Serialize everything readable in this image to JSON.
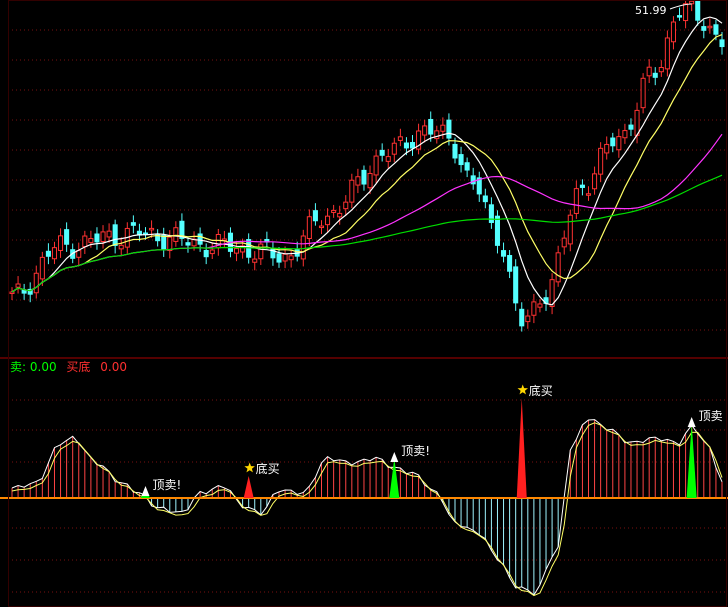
{
  "colors": {
    "background": "#000000",
    "up_candle": "#ff3232",
    "down_candle": "#54ffff",
    "ma_short": "#ffffff",
    "ma_mid": "#ffff66",
    "ma_long": "#ff33ff",
    "ma_longest": "#00dd00",
    "grid": "#7a1010",
    "separator": "#aa0000",
    "zero_line": "#ff8800",
    "bottom_buy": "#ff2020",
    "top_sell": "#00ff00",
    "annotation_text": "#ffffff",
    "label_sell": "#00ff00",
    "label_buy": "#ff3030"
  },
  "header": {
    "sell_label": "卖",
    "sell_value": "0.00",
    "bottom_label": "买底",
    "bottom_value": "0.00"
  },
  "price_high_label": "51.99",
  "chart_data": [
    {
      "type": "candlestick",
      "title": "",
      "x_count": 118,
      "max_price": 51.99,
      "max_index": 112,
      "trend_anchors": [
        [
          0,
          0.1
        ],
        [
          8,
          0.26
        ],
        [
          20,
          0.3
        ],
        [
          35,
          0.26
        ],
        [
          45,
          0.23
        ],
        [
          52,
          0.36
        ],
        [
          62,
          0.55
        ],
        [
          68,
          0.62
        ],
        [
          72,
          0.6
        ],
        [
          76,
          0.45
        ],
        [
          80,
          0.3
        ],
        [
          84,
          0.02
        ],
        [
          88,
          0.12
        ],
        [
          94,
          0.45
        ],
        [
          100,
          0.6
        ],
        [
          106,
          0.8
        ],
        [
          110,
          1.0
        ],
        [
          114,
          0.96
        ],
        [
          117,
          0.9
        ]
      ],
      "moving_averages": [
        {
          "name": "MA5",
          "window": 3,
          "color": "ma_short"
        },
        {
          "name": "MA10",
          "window": 6,
          "color": "ma_mid"
        },
        {
          "name": "MA30",
          "window": 16,
          "color": "ma_long"
        },
        {
          "name": "MA60",
          "window": 40,
          "color": "ma_longest"
        }
      ]
    },
    {
      "type": "bar",
      "title": "",
      "x_count": 118,
      "ylim": [
        -1,
        1
      ],
      "osc_anchors": [
        [
          0,
          0.1
        ],
        [
          4,
          0.15
        ],
        [
          8,
          0.55
        ],
        [
          10,
          0.6
        ],
        [
          14,
          0.35
        ],
        [
          18,
          0.15
        ],
        [
          21,
          0.05
        ],
        [
          24,
          -0.1
        ],
        [
          28,
          -0.15
        ],
        [
          31,
          0.05
        ],
        [
          35,
          0.12
        ],
        [
          38,
          -0.08
        ],
        [
          41,
          -0.15
        ],
        [
          44,
          0.08
        ],
        [
          48,
          0.05
        ],
        [
          52,
          0.4
        ],
        [
          56,
          0.35
        ],
        [
          60,
          0.4
        ],
        [
          63,
          0.3
        ],
        [
          66,
          0.25
        ],
        [
          70,
          0.05
        ],
        [
          73,
          -0.25
        ],
        [
          77,
          -0.35
        ],
        [
          80,
          -0.6
        ],
        [
          83,
          -0.88
        ],
        [
          86,
          -0.95
        ],
        [
          90,
          -0.5
        ],
        [
          92,
          0.5
        ],
        [
          95,
          0.8
        ],
        [
          98,
          0.7
        ],
        [
          102,
          0.55
        ],
        [
          106,
          0.6
        ],
        [
          110,
          0.55
        ],
        [
          112,
          0.72
        ],
        [
          115,
          0.5
        ],
        [
          117,
          0.15
        ]
      ],
      "signals": [
        {
          "type": "sell",
          "index": 22,
          "height": 0.06,
          "label": "顶卖!"
        },
        {
          "type": "buy",
          "index": 39,
          "height": 0.22,
          "label": "底买"
        },
        {
          "type": "sell",
          "index": 63,
          "height": 0.4,
          "label": "顶卖!"
        },
        {
          "type": "buy",
          "index": 84,
          "height": 1.0,
          "label": "底买"
        },
        {
          "type": "sell",
          "index": 112,
          "height": 0.75,
          "label": "顶卖"
        }
      ]
    }
  ]
}
